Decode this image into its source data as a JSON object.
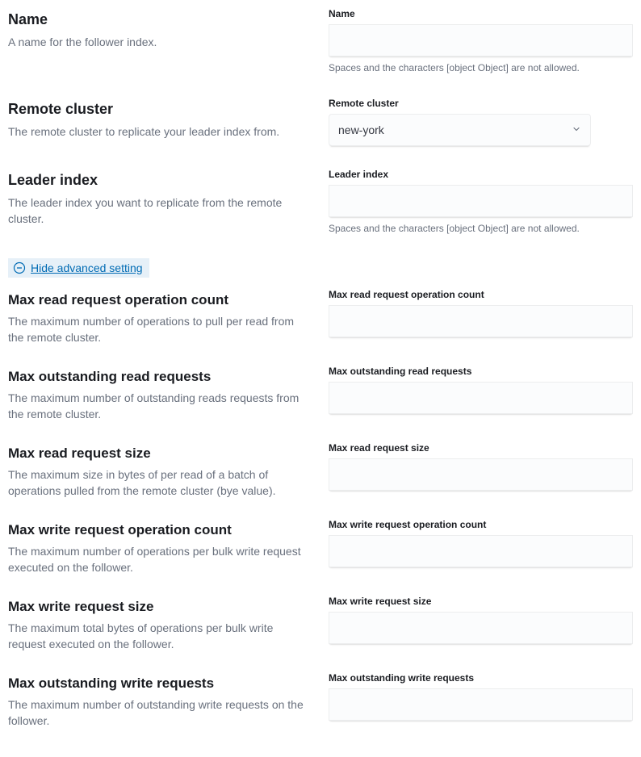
{
  "name": {
    "title": "Name",
    "description": "A name for the follower index.",
    "field_label": "Name",
    "value": "",
    "help_text": "Spaces and the characters [object Object] are not allowed."
  },
  "remote_cluster": {
    "title": "Remote cluster",
    "description": "The remote cluster to replicate your leader index from.",
    "field_label": "Remote cluster",
    "value": "new-york"
  },
  "leader_index": {
    "title": "Leader index",
    "description": "The leader index you want to replicate from the remote cluster.",
    "field_label": "Leader index",
    "value": "",
    "help_text": "Spaces and the characters [object Object] are not allowed."
  },
  "toggle": {
    "text": "Hide advanced setting"
  },
  "advanced": {
    "max_read_request_operation_count": {
      "title": "Max read request operation count",
      "description": "The maximum number of operations to pull per read from the remote cluster.",
      "field_label": "Max read request operation count",
      "value": ""
    },
    "max_outstanding_read_requests": {
      "title": "Max outstanding read requests",
      "description": "The maximum number of outstanding reads requests from the remote cluster.",
      "field_label": "Max outstanding read requests",
      "value": ""
    },
    "max_read_request_size": {
      "title": "Max read request size",
      "description": "The maximum size in bytes of per read of a batch of operations pulled from the remote cluster (bye value).",
      "field_label": "Max read request size",
      "value": ""
    },
    "max_write_request_operation_count": {
      "title": "Max write request operation count",
      "description": "The maximum number of operations per bulk write request executed on the follower.",
      "field_label": "Max write request operation count",
      "value": ""
    },
    "max_write_request_size": {
      "title": "Max write request size",
      "description": "The maximum total bytes of operations per bulk write request executed on the follower.",
      "field_label": "Max write request size",
      "value": ""
    },
    "max_outstanding_write_requests": {
      "title": "Max outstanding write requests",
      "description": "The maximum number of outstanding write requests on the follower.",
      "field_label": "Max outstanding write requests",
      "value": ""
    }
  }
}
